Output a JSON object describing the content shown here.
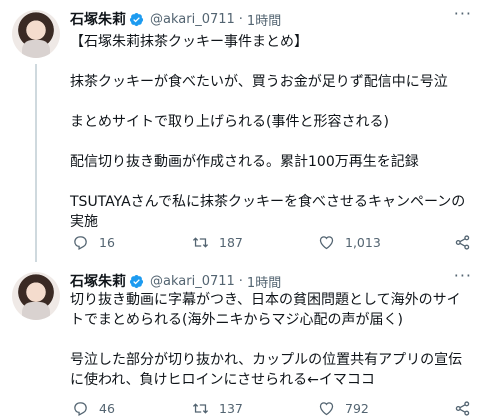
{
  "tweets": [
    {
      "author": "石塚朱莉",
      "handle": "@akari_0711",
      "separator": "·",
      "time": "1時間",
      "paragraphs": [
        "【石塚朱莉抹茶クッキー事件まとめ】",
        "抹茶クッキーが食べたいが、買うお金が足りず配信中に号泣",
        "まとめサイトで取り上げられる(事件と形容される)",
        "配信切り抜き動画が作成される。累計100万再生を記録",
        "TSUTAYAさんで私に抹茶クッキーを食べさせるキャンペーンの実施"
      ],
      "replies": "16",
      "retweets": "187",
      "likes": "1,013"
    },
    {
      "author": "石塚朱莉",
      "handle": "@akari_0711",
      "separator": "·",
      "time": "1時間",
      "paragraphs": [
        "切り抜き動画に字幕がつき、日本の貧困問題として海外のサイトでまとめられる(海外ニキからマジ心配の声が届く)",
        "号泣した部分が切り抜かれ、カップルの位置共有アプリの宣伝に使われ、負けヒロインにさせられる←イマココ"
      ],
      "replies": "46",
      "retweets": "137",
      "likes": "792"
    }
  ],
  "colors": {
    "verified": "#1d9bf0",
    "text": "#0f1419",
    "muted": "#536471"
  },
  "icons": [
    "verified-badge-icon",
    "more-icon",
    "reply-icon",
    "retweet-icon",
    "like-icon",
    "share-icon"
  ]
}
